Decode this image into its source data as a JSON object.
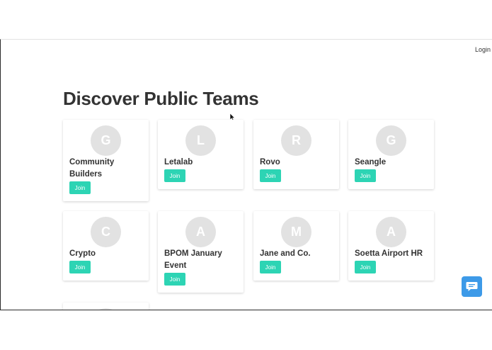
{
  "header": {
    "login_label": "Login"
  },
  "page": {
    "title": "Discover Public Teams"
  },
  "join_label": "Join",
  "teams": [
    {
      "initial": "G",
      "name": "Community Builders"
    },
    {
      "initial": "L",
      "name": "Letalab"
    },
    {
      "initial": "R",
      "name": "Rovo"
    },
    {
      "initial": "G",
      "name": "Seangle"
    },
    {
      "initial": "C",
      "name": "Crypto"
    },
    {
      "initial": "A",
      "name": "BPOM January Event"
    },
    {
      "initial": "M",
      "name": "Jane and Co."
    },
    {
      "initial": "A",
      "name": "Soetta Airport HR"
    }
  ],
  "icons": {
    "chat": "chat-bubble-icon",
    "cursor": "mouse-pointer-icon"
  },
  "colors": {
    "accent": "#2dd4b4",
    "avatar_bg": "#e2e2e2",
    "chat": "#3d9ae8"
  }
}
